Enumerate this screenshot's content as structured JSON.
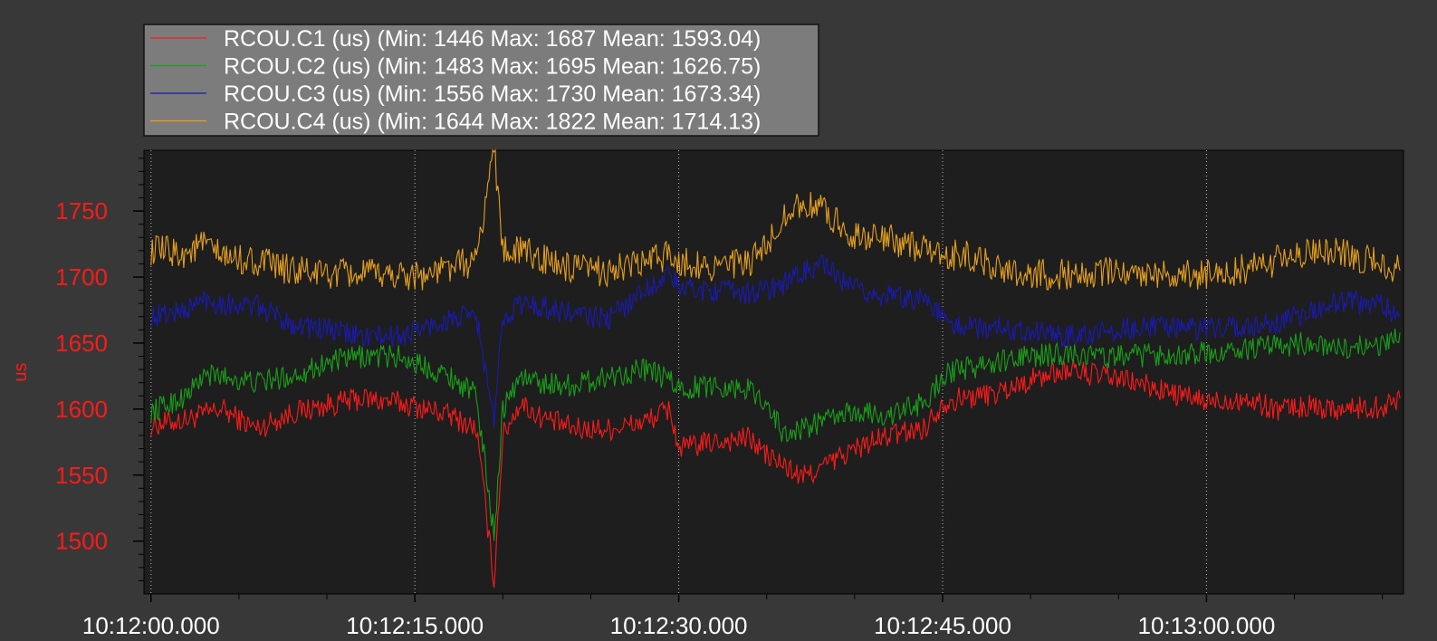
{
  "chart_data": {
    "type": "line",
    "xlabel": "",
    "ylabel": "us",
    "x_ticks": [
      "10:12:00.000",
      "10:12:15.000",
      "10:12:30.000",
      "10:12:45.000",
      "10:13:00.000"
    ],
    "x_tick_seconds": [
      0,
      15,
      30,
      45,
      60
    ],
    "xlim": [
      -0.4,
      71.2
    ],
    "y_ticks": [
      1500,
      1550,
      1600,
      1650,
      1700,
      1750
    ],
    "ylim": [
      1460,
      1796
    ],
    "grid": true,
    "legend_position": "top-left",
    "series": [
      {
        "name": "RCOU.C1 (us)",
        "legend": "RCOU.C1 (us) (Min: 1446 Max: 1687 Mean: 1593.04)",
        "color": "#ff1a1a",
        "x": [
          0,
          2,
          3,
          4,
          6,
          8,
          10,
          12,
          14,
          16,
          17,
          18.5,
          19.5,
          20,
          21,
          22,
          24,
          26,
          28,
          29.5,
          30,
          32,
          34,
          35,
          36,
          37,
          38,
          40,
          42,
          44,
          45,
          46,
          48,
          50,
          52,
          54,
          56,
          58,
          60,
          62,
          64,
          66,
          68,
          70,
          71
        ],
        "y": [
          1588,
          1592,
          1596,
          1600,
          1585,
          1597,
          1603,
          1608,
          1605,
          1599,
          1595,
          1585,
          1470,
          1580,
          1605,
          1595,
          1585,
          1585,
          1590,
          1600,
          1570,
          1575,
          1578,
          1565,
          1557,
          1548,
          1555,
          1570,
          1580,
          1586,
          1605,
          1608,
          1612,
          1622,
          1630,
          1625,
          1620,
          1612,
          1605,
          1608,
          1600,
          1602,
          1600,
          1602,
          1608
        ]
      },
      {
        "name": "RCOU.C2 (us)",
        "legend": "RCOU.C2 (us) (Min: 1483 Max: 1695 Mean: 1626.75)",
        "color": "#1aa01a",
        "x": [
          0,
          2,
          3,
          4,
          6,
          8,
          10,
          12,
          14,
          16,
          17,
          18.5,
          19.5,
          20,
          21,
          22,
          24,
          26,
          28,
          29.5,
          30,
          32,
          34,
          35,
          36,
          37,
          38,
          40,
          42,
          44,
          45,
          46,
          48,
          50,
          52,
          54,
          56,
          58,
          60,
          62,
          64,
          66,
          68,
          70,
          71
        ],
        "y": [
          1598,
          1610,
          1625,
          1625,
          1620,
          1625,
          1635,
          1640,
          1640,
          1630,
          1625,
          1610,
          1505,
          1600,
          1625,
          1620,
          1618,
          1625,
          1630,
          1622,
          1615,
          1618,
          1615,
          1605,
          1580,
          1585,
          1590,
          1598,
          1595,
          1605,
          1625,
          1630,
          1635,
          1640,
          1642,
          1640,
          1640,
          1642,
          1642,
          1645,
          1648,
          1650,
          1645,
          1650,
          1658
        ]
      },
      {
        "name": "RCOU.C3 (us)",
        "legend": "RCOU.C3 (us) (Min: 1556 Max: 1730 Mean: 1673.34)",
        "color": "#1a1ab4",
        "x": [
          0,
          2,
          3,
          4,
          6,
          8,
          10,
          12,
          14,
          16,
          17,
          18.5,
          19.5,
          20,
          21,
          22,
          24,
          26,
          28,
          29.5,
          30,
          32,
          34,
          35,
          36,
          37,
          38,
          40,
          42,
          44,
          45,
          46,
          48,
          50,
          52,
          54,
          56,
          58,
          60,
          62,
          64,
          66,
          68,
          70,
          71
        ],
        "y": [
          1670,
          1675,
          1683,
          1680,
          1678,
          1665,
          1660,
          1655,
          1655,
          1663,
          1668,
          1670,
          1590,
          1670,
          1680,
          1678,
          1672,
          1668,
          1690,
          1702,
          1692,
          1690,
          1688,
          1690,
          1695,
          1703,
          1710,
          1690,
          1685,
          1685,
          1668,
          1662,
          1662,
          1660,
          1655,
          1658,
          1662,
          1662,
          1660,
          1663,
          1665,
          1675,
          1682,
          1678,
          1672
        ]
      },
      {
        "name": "RCOU.C4 (us)",
        "legend": "RCOU.C4 (us) (Min: 1644 Max: 1822 Mean: 1714.13)",
        "color": "#e6a020",
        "x": [
          0,
          2,
          3,
          4,
          6,
          8,
          10,
          12,
          14,
          16,
          17,
          18.5,
          19.5,
          20,
          21,
          22,
          24,
          26,
          28,
          29.5,
          30,
          32,
          34,
          35,
          36,
          37,
          38,
          40,
          42,
          44,
          45,
          46,
          48,
          50,
          52,
          54,
          56,
          58,
          60,
          62,
          64,
          66,
          68,
          70,
          71
        ],
        "y": [
          1720,
          1718,
          1725,
          1715,
          1712,
          1705,
          1702,
          1702,
          1702,
          1702,
          1708,
          1712,
          1800,
          1720,
          1720,
          1715,
          1705,
          1705,
          1710,
          1718,
          1712,
          1708,
          1710,
          1722,
          1748,
          1755,
          1752,
          1732,
          1728,
          1722,
          1712,
          1718,
          1708,
          1702,
          1702,
          1703,
          1705,
          1702,
          1702,
          1706,
          1712,
          1722,
          1718,
          1710,
          1705
        ]
      }
    ]
  }
}
